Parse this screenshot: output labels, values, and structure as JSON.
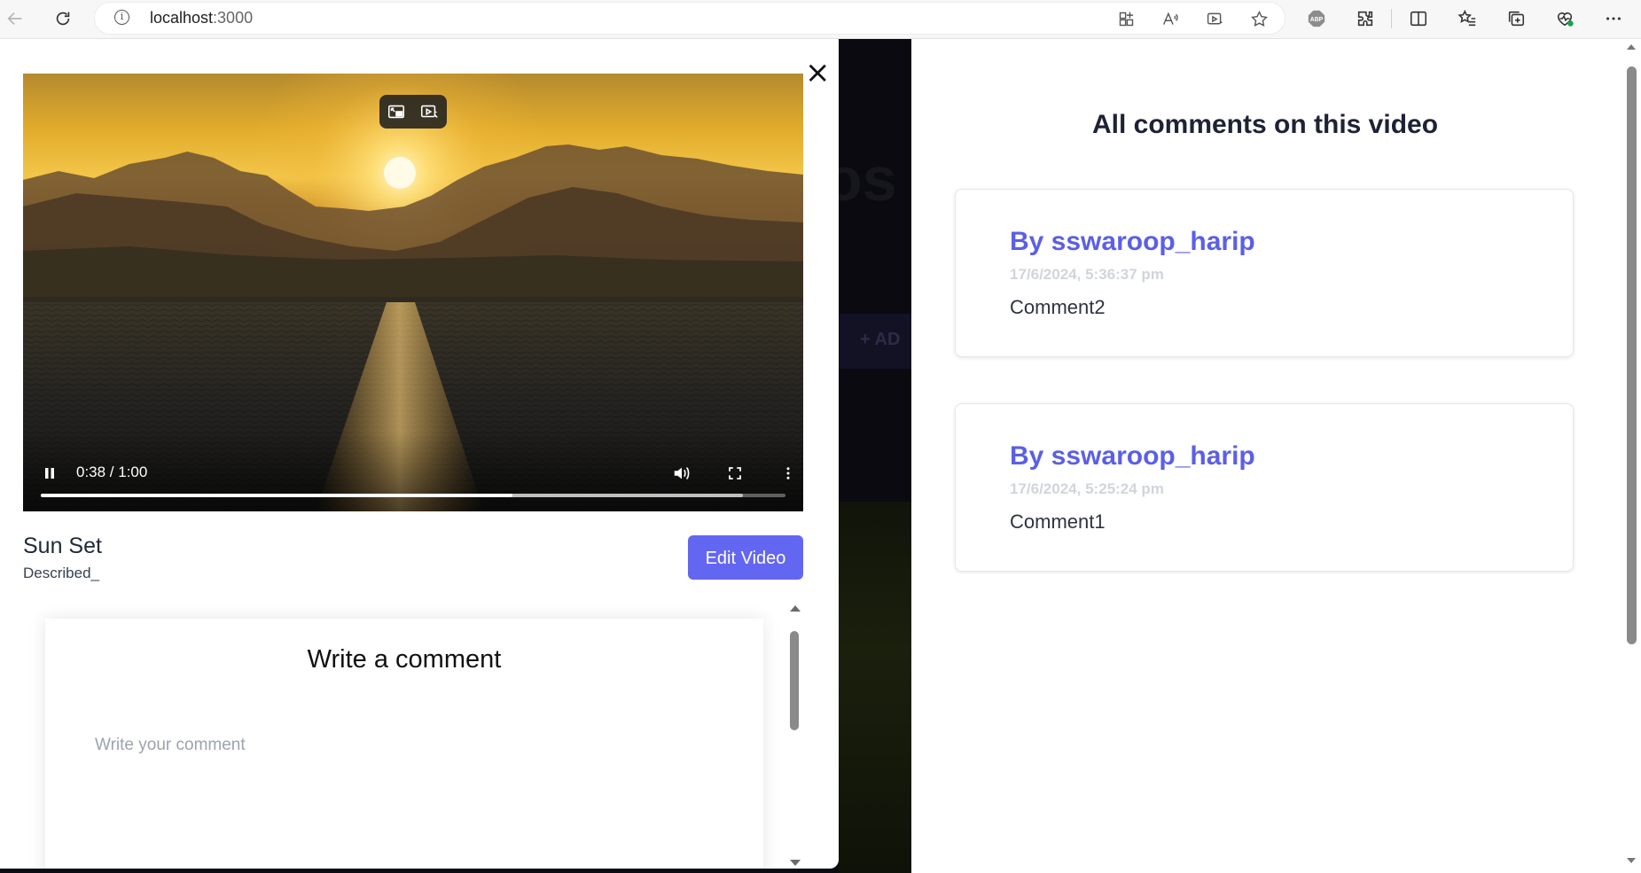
{
  "browser": {
    "url_host": "localhost",
    "url_port": ":3000",
    "icons": [
      "back-arrow-icon",
      "reload-icon",
      "site-info-icon",
      "apps-icon",
      "read-aloud-icon",
      "video-enhance-icon",
      "favorite-star-icon",
      "adblock-icon",
      "extensions-icon",
      "split-screen-icon",
      "favorites-icon",
      "collections-icon",
      "browser-essentials-icon",
      "more-icon"
    ],
    "adblock_label": "ABP"
  },
  "background": {
    "heading_fragment": "os I",
    "button_fragment": "+ AD"
  },
  "modal": {
    "close_label": "×",
    "video": {
      "time": "0:38 / 1:00",
      "played_fraction": 0.633,
      "buffered_fraction": 0.943,
      "state": "playing"
    },
    "title": "Sun Set",
    "description": "Described_",
    "edit_button": "Edit Video",
    "comment_form": {
      "heading": "Write a comment",
      "placeholder": "Write your comment",
      "value": ""
    }
  },
  "comments_panel": {
    "heading": "All comments on this video",
    "comments": [
      {
        "author": "By sswaroop_harip",
        "timestamp": "17/6/2024, 5:36:37 pm",
        "text": "Comment2"
      },
      {
        "author": "By sswaroop_harip",
        "timestamp": "17/6/2024, 5:25:24 pm",
        "text": "Comment1"
      }
    ]
  },
  "colors": {
    "accent": "#6366f1",
    "author": "#5b5fe6",
    "timestamp": "#d1d5db",
    "backdrop": "#0b0b12"
  }
}
